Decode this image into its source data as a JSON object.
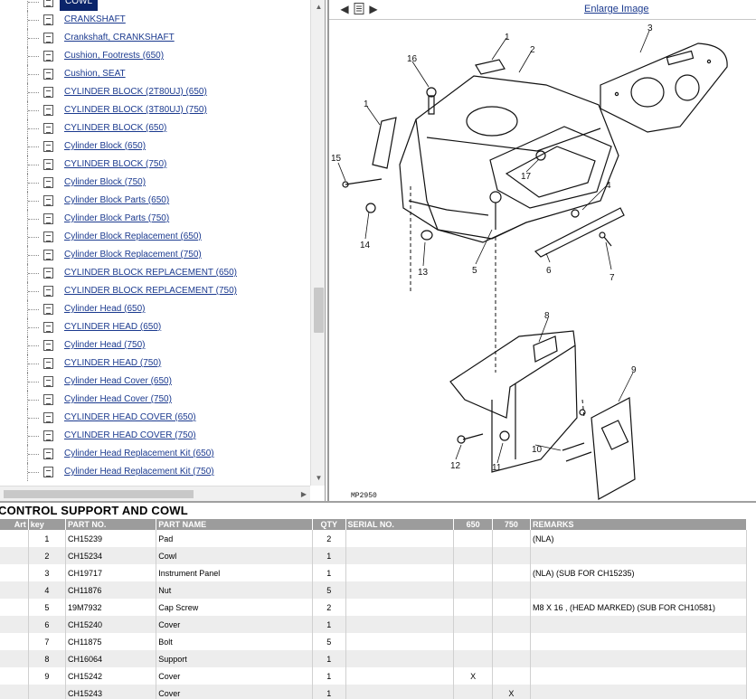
{
  "tree": {
    "items": [
      {
        "label": "COWL",
        "selected": true
      },
      {
        "label": "CRANKSHAFT"
      },
      {
        "label": "Crankshaft, CRANKSHAFT"
      },
      {
        "label": "Cushion, Footrests (650)"
      },
      {
        "label": "Cushion, SEAT"
      },
      {
        "label": "CYLINDER BLOCK (2T80UJ) (650)"
      },
      {
        "label": "CYLINDER BLOCK (3T80UJ) (750)"
      },
      {
        "label": "CYLINDER BLOCK (650)"
      },
      {
        "label": "Cylinder Block (650)"
      },
      {
        "label": "CYLINDER BLOCK (750)"
      },
      {
        "label": "Cylinder Block (750)"
      },
      {
        "label": "Cylinder Block Parts (650)"
      },
      {
        "label": "Cylinder Block Parts (750)"
      },
      {
        "label": "Cylinder Block Replacement (650)"
      },
      {
        "label": "Cylinder Block Replacement (750)"
      },
      {
        "label": "CYLINDER BLOCK REPLACEMENT (650)"
      },
      {
        "label": "CYLINDER BLOCK REPLACEMENT (750)"
      },
      {
        "label": "Cylinder Head (650)"
      },
      {
        "label": "CYLINDER HEAD (650)"
      },
      {
        "label": "Cylinder Head (750)"
      },
      {
        "label": "CYLINDER HEAD (750)"
      },
      {
        "label": "Cylinder Head Cover (650)"
      },
      {
        "label": "Cylinder Head Cover (750)"
      },
      {
        "label": "CYLINDER HEAD COVER (650)"
      },
      {
        "label": "CYLINDER HEAD COVER (750)"
      },
      {
        "label": "Cylinder Head Replacement Kit (650)"
      },
      {
        "label": "Cylinder Head Replacement Kit (750)"
      }
    ]
  },
  "image_panel": {
    "enlarge_label": "Enlarge Image",
    "figure_code": "MP2950",
    "callouts": [
      "1",
      "2",
      "3",
      "16",
      "1",
      "15",
      "17",
      "4",
      "14",
      "13",
      "5",
      "6",
      "7",
      "8",
      "9",
      "10",
      "12",
      "11"
    ]
  },
  "section": {
    "title": "CONTROL SUPPORT AND COWL"
  },
  "parts_table": {
    "headers": [
      "Art",
      "key",
      "PART NO.",
      "PART NAME",
      "QTY",
      "SERIAL NO.",
      "650",
      "750",
      "REMARKS"
    ],
    "rows": [
      {
        "art": "",
        "key": "1",
        "part_no": "CH15239",
        "name": "Pad",
        "qty": "2",
        "serial": "",
        "m650": "",
        "m750": "",
        "remarks": "(NLA)"
      },
      {
        "art": "",
        "key": "2",
        "part_no": "CH15234",
        "name": "Cowl",
        "qty": "1",
        "serial": "",
        "m650": "",
        "m750": "",
        "remarks": ""
      },
      {
        "art": "",
        "key": "3",
        "part_no": "CH19717",
        "name": "Instrument Panel",
        "qty": "1",
        "serial": "",
        "m650": "",
        "m750": "",
        "remarks": "(NLA) (SUB FOR CH15235)"
      },
      {
        "art": "",
        "key": "4",
        "part_no": "CH11876",
        "name": "Nut",
        "qty": "5",
        "serial": "",
        "m650": "",
        "m750": "",
        "remarks": ""
      },
      {
        "art": "",
        "key": "5",
        "part_no": "19M7932",
        "name": "Cap Screw",
        "qty": "2",
        "serial": "",
        "m650": "",
        "m750": "",
        "remarks": "M8 X 16 , (HEAD MARKED) (SUB FOR CH10581)"
      },
      {
        "art": "",
        "key": "6",
        "part_no": "CH15240",
        "name": "Cover",
        "qty": "1",
        "serial": "",
        "m650": "",
        "m750": "",
        "remarks": ""
      },
      {
        "art": "",
        "key": "7",
        "part_no": "CH11875",
        "name": "Bolt",
        "qty": "5",
        "serial": "",
        "m650": "",
        "m750": "",
        "remarks": ""
      },
      {
        "art": "",
        "key": "8",
        "part_no": "CH16064",
        "name": "Support",
        "qty": "1",
        "serial": "",
        "m650": "",
        "m750": "",
        "remarks": ""
      },
      {
        "art": "",
        "key": "9",
        "part_no": "CH15242",
        "name": "Cover",
        "qty": "1",
        "serial": "",
        "m650": "X",
        "m750": "",
        "remarks": ""
      },
      {
        "art": "",
        "key": "",
        "part_no": "CH15243",
        "name": "Cover",
        "qty": "1",
        "serial": "",
        "m650": "",
        "m750": "X",
        "remarks": ""
      }
    ]
  }
}
